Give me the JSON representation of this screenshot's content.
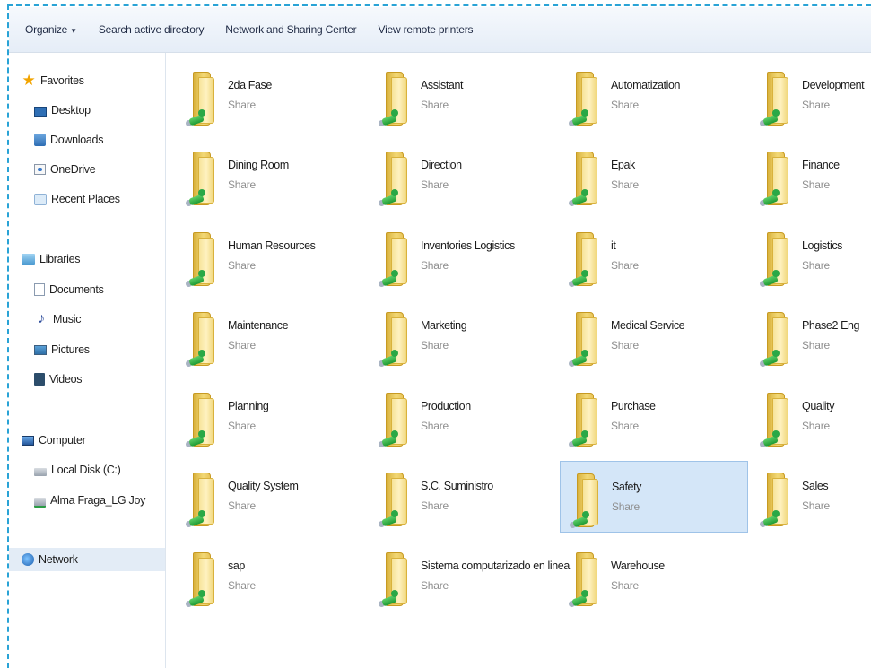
{
  "toolbar": {
    "organize": "Organize",
    "search_ad": "Search active directory",
    "network_sharing": "Network and Sharing Center",
    "view_printers": "View remote printers"
  },
  "nav": {
    "favorites": "Favorites",
    "desktop": "Desktop",
    "downloads": "Downloads",
    "onedrive": "OneDrive",
    "recent_places": "Recent Places",
    "libraries": "Libraries",
    "documents": "Documents",
    "music": "Music",
    "pictures": "Pictures",
    "videos": "Videos",
    "computer": "Computer",
    "local_disk": "Local Disk (C:)",
    "network_drive": "Alma Fraga_LG Joy",
    "network": "Network"
  },
  "shares": [
    {
      "name": "2da Fase",
      "type": "Share"
    },
    {
      "name": "Assistant",
      "type": "Share"
    },
    {
      "name": "Automatization",
      "type": "Share"
    },
    {
      "name": "Development",
      "type": "Share"
    },
    {
      "name": "Dining Room",
      "type": "Share"
    },
    {
      "name": "Direction",
      "type": "Share"
    },
    {
      "name": "Epak",
      "type": "Share"
    },
    {
      "name": "Finance",
      "type": "Share"
    },
    {
      "name": "Human Resources",
      "type": "Share"
    },
    {
      "name": "Inventories Logistics",
      "type": "Share"
    },
    {
      "name": "it",
      "type": "Share"
    },
    {
      "name": "Logistics",
      "type": "Share"
    },
    {
      "name": "Maintenance",
      "type": "Share"
    },
    {
      "name": "Marketing",
      "type": "Share"
    },
    {
      "name": "Medical Service",
      "type": "Share"
    },
    {
      "name": "Phase2 Eng",
      "type": "Share"
    },
    {
      "name": "Planning",
      "type": "Share"
    },
    {
      "name": "Production",
      "type": "Share"
    },
    {
      "name": "Purchase",
      "type": "Share"
    },
    {
      "name": "Quality",
      "type": "Share"
    },
    {
      "name": "Quality System",
      "type": "Share"
    },
    {
      "name": "S.C. Suministro",
      "type": "Share"
    },
    {
      "name": "Safety",
      "type": "Share",
      "selected": true
    },
    {
      "name": "Sales",
      "type": "Share"
    },
    {
      "name": "sap",
      "type": "Share"
    },
    {
      "name": "Sistema computarizado en linea",
      "type": "Share"
    },
    {
      "name": "Warehouse",
      "type": "Share"
    }
  ]
}
